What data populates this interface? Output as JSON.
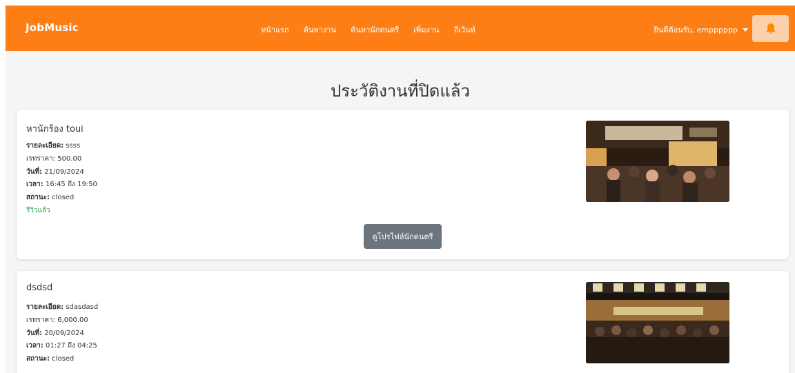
{
  "navbar": {
    "brand": "JobMusic",
    "links": [
      "หน้าแรก",
      "ค้นหางาน",
      "ค้นหานักดนตรี",
      "เพิ่มงาน",
      "อีเว้นท์"
    ],
    "user_greeting": "ยินดีต้อนรับ, empppppp",
    "bell_icon": "bell-icon"
  },
  "page_title": "ประวัติงานที่ปิดแล้ว",
  "jobs": [
    {
      "title": "หานักร้อง toui",
      "details_label": "รายละเอียด:",
      "details": "ssss",
      "price_label": "เรทราคา:",
      "price": "500.00",
      "date_label": "วันที่:",
      "date": "21/09/2024",
      "time_label": "เวลา:",
      "time": "16:45 ถึง 19:50",
      "status_label": "สถานะ:",
      "status": "closed",
      "review_status": "รีวิวแล้ว",
      "profile_button": "ดูโปรไฟล์นักดนตรี"
    },
    {
      "title": "dsdsd",
      "details_label": "รายละเอียด:",
      "details": "sdasdasd",
      "price_label": "เรทราคา:",
      "price": "6,000.00",
      "date_label": "วันที่:",
      "date": "20/09/2024",
      "time_label": "เวลา:",
      "time": "01:27 ถึง 04:25",
      "status_label": "สถานะ:",
      "status": "closed"
    }
  ],
  "colors": {
    "navbar": "#fd7e14",
    "bell_button": "#fbd0ad",
    "bell_icon": "#ff8a00",
    "reviewed": "#28a745",
    "profile_button": "#6c757d"
  }
}
